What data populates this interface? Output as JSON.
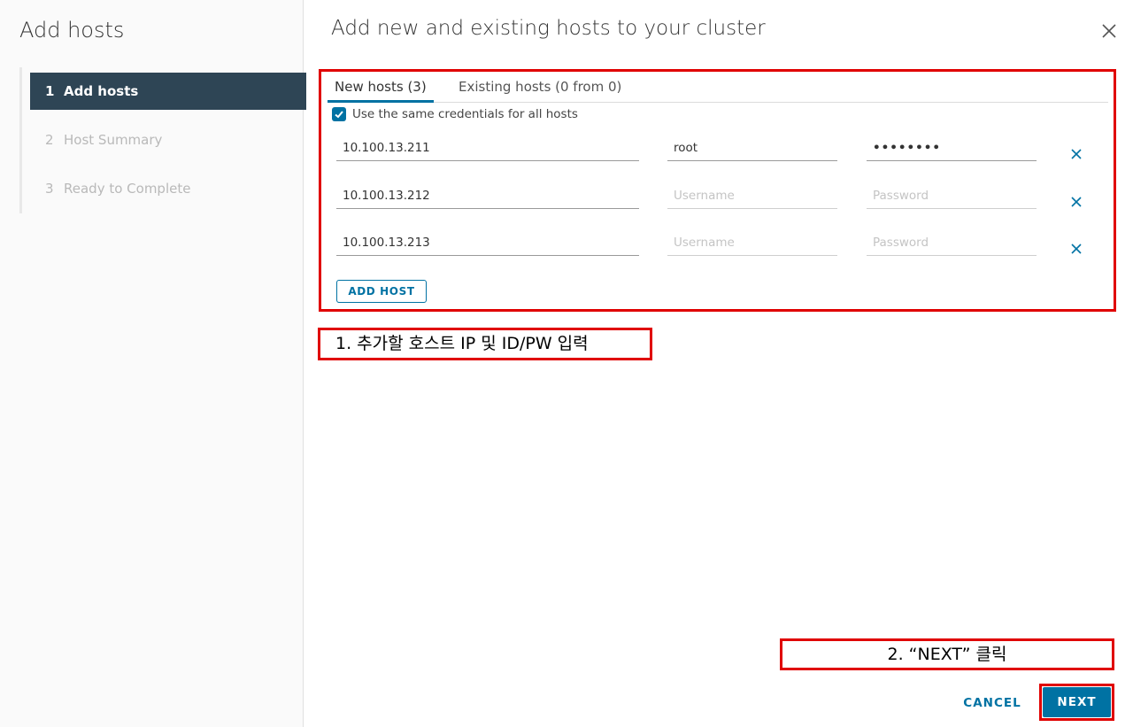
{
  "sidebar": {
    "title": "Add hosts",
    "steps": [
      {
        "num": "1",
        "label": "Add hosts"
      },
      {
        "num": "2",
        "label": "Host Summary"
      },
      {
        "num": "3",
        "label": "Ready to Complete"
      }
    ]
  },
  "main": {
    "title": "Add new and existing hosts to your cluster",
    "tabs": [
      {
        "label": "New hosts (3)"
      },
      {
        "label": "Existing hosts (0 from 0)"
      }
    ],
    "same_credentials_label": "Use the same credentials for all hosts",
    "hosts": [
      {
        "ip": "10.100.13.211",
        "username": "root",
        "password": "••••••••"
      },
      {
        "ip": "10.100.13.212",
        "username_placeholder": "Username",
        "password_placeholder": "Password"
      },
      {
        "ip": "10.100.13.213",
        "username_placeholder": "Username",
        "password_placeholder": "Password"
      }
    ],
    "add_host_label": "ADD HOST"
  },
  "annotations": {
    "note1": "1. 추가할 호스트 IP 및 ID/PW 입력",
    "note2": "2. “NEXT” 클릭"
  },
  "footer": {
    "cancel_label": "CANCEL",
    "next_label": "NEXT"
  },
  "colors": {
    "accent": "#0072a3",
    "active_step_bg": "#2e4555",
    "annotation_red": "#e00000"
  },
  "icons": {
    "close": "close-icon",
    "remove": "remove-icon",
    "check": "check-icon"
  }
}
